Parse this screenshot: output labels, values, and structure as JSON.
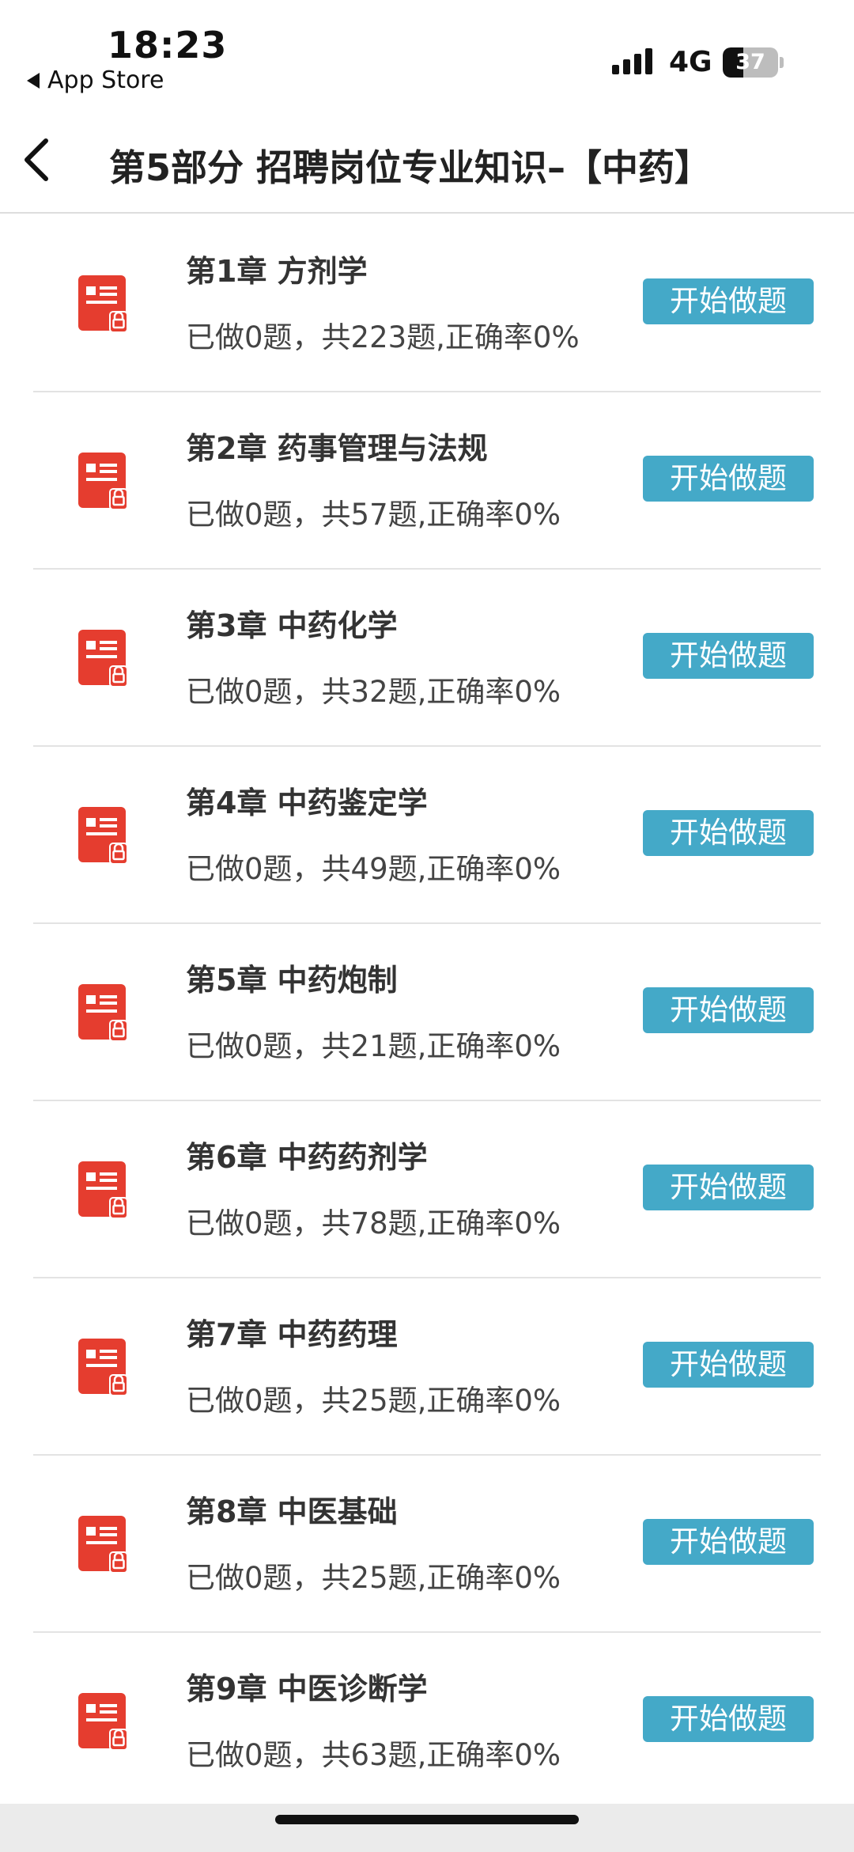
{
  "status_bar": {
    "time": "18:23",
    "back_app": "App Store",
    "network": "4G",
    "battery": "37",
    "battery_level": 0.37
  },
  "nav": {
    "title": "第5部分 招聘岗位专业知识–【中药】"
  },
  "chapters": [
    {
      "title": "第1章 方剂学",
      "stats": "已做0题，共223题,正确率0%",
      "button": "开始做题"
    },
    {
      "title": "第2章 药事管理与法规",
      "stats": "已做0题，共57题,正确率0%",
      "button": "开始做题"
    },
    {
      "title": "第3章 中药化学",
      "stats": "已做0题，共32题,正确率0%",
      "button": "开始做题"
    },
    {
      "title": "第4章 中药鉴定学",
      "stats": "已做0题，共49题,正确率0%",
      "button": "开始做题"
    },
    {
      "title": "第5章 中药炮制",
      "stats": "已做0题，共21题,正确率0%",
      "button": "开始做题"
    },
    {
      "title": "第6章 中药药剂学",
      "stats": "已做0题，共78题,正确率0%",
      "button": "开始做题"
    },
    {
      "title": "第7章 中药药理",
      "stats": "已做0题，共25题,正确率0%",
      "button": "开始做题"
    },
    {
      "title": "第8章 中医基础",
      "stats": "已做0题，共25题,正确率0%",
      "button": "开始做题"
    },
    {
      "title": "第9章 中医诊断学",
      "stats": "已做0题，共63题,正确率0%",
      "button": "开始做题"
    }
  ],
  "icons": {
    "chapter_icon": "locked-document-icon",
    "nav_back": "chevron-left-icon"
  },
  "colors": {
    "button_bg": "#44a9c8",
    "icon_red": "#e53d2f"
  }
}
